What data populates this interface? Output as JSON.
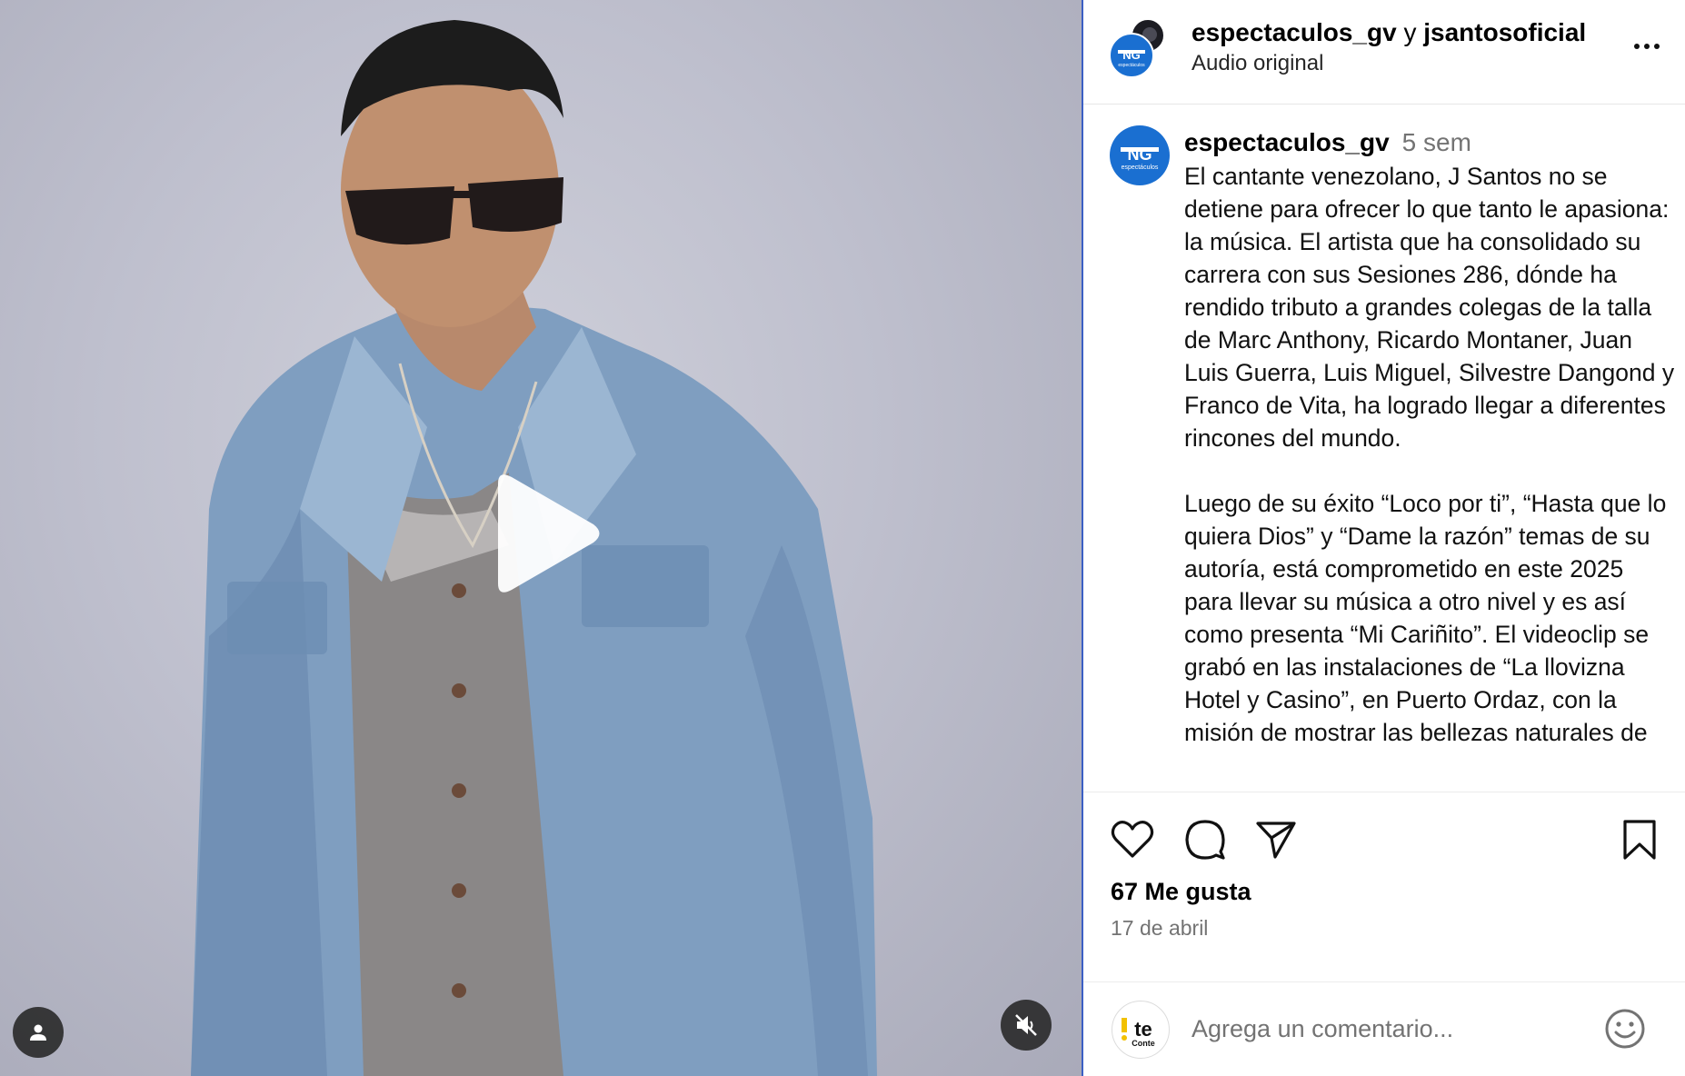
{
  "colors": {
    "brand_blue": "#1a6fd1",
    "divider": "#3b5fc4",
    "muted_text": "#737373",
    "media_bg": "#bfc0ce",
    "jacket_denim": "#7f9ec0"
  },
  "media": {
    "play_icon": "play-icon",
    "tag_icon": "user-icon",
    "mute_icon": "speaker-muted-icon",
    "brand_text": "NG",
    "brand_sub": "espectáculos"
  },
  "header": {
    "user1": "espectaculos_gv",
    "connector": "y",
    "user2": "jsantosoficial",
    "subtitle": "Audio original",
    "more_icon": "more-options-icon"
  },
  "caption": {
    "username": "espectaculos_gv",
    "time": "5 sem",
    "text": "El cantante venezolano, J Santos no se detiene para ofrecer lo que tanto le apasiona: la música. El artista que ha consolidado su carrera con sus Sesiones 286, dónde ha rendido tributo a grandes colegas de la talla de Marc Anthony, Ricardo Montaner, Juan Luis Guerra, Luis Miguel, Silvestre Dangond y Franco de Vita, ha logrado llegar a diferentes rincones del mundo.\n\nLuego de su éxito “Loco por ti”, “Hasta que lo quiera Dios” y “Dame la razón” temas de su autoría, está comprometido en este 2025 para llevar su música a otro nivel y es así como presenta “Mi Cariñito”. El videoclip se grabó en las instalaciones de “La llovizna Hotel y Casino”, en Puerto Ordaz, con la misión de mostrar las bellezas naturales de"
  },
  "actions": {
    "like_icon": "heart-icon",
    "comment_icon": "comment-icon",
    "share_icon": "send-icon",
    "save_icon": "bookmark-icon"
  },
  "likes": "67 Me gusta",
  "date": "17 de abril",
  "comment": {
    "placeholder": "Agrega un comentario...",
    "avatar_text": "te",
    "avatar_sub": "Conte",
    "emoji_icon": "emoji-icon"
  }
}
